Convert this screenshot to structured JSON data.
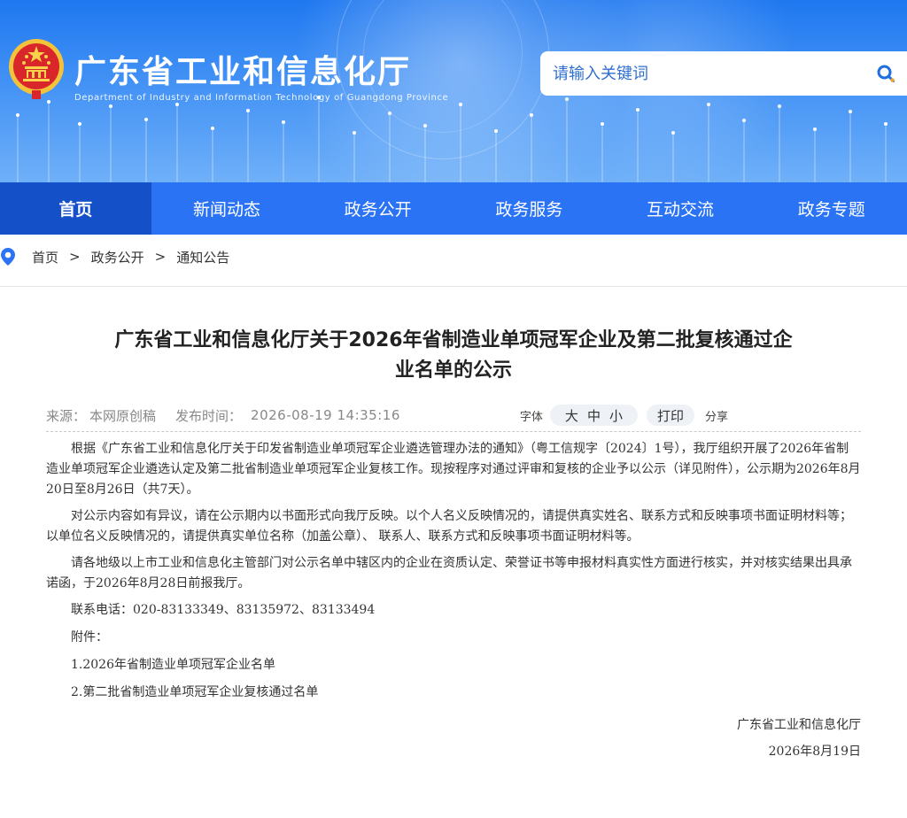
{
  "header": {
    "title": "广东省工业和信息化厅",
    "subtitle": "Department of Industry and Information Technology of Guangdong Province",
    "search_placeholder": "请输入关键词"
  },
  "nav": {
    "items": [
      {
        "label": "首页",
        "active": true
      },
      {
        "label": "新闻动态"
      },
      {
        "label": "政务公开"
      },
      {
        "label": "政务服务"
      },
      {
        "label": "互动交流"
      },
      {
        "label": "政务专题"
      }
    ]
  },
  "breadcrumb": {
    "sep": ">",
    "items": [
      "首页",
      "政务公开",
      "通知公告"
    ]
  },
  "article": {
    "title_line1": "广东省工业和信息化厅关于2026年省制造业单项冠军企业及第二批复核通过企",
    "title_line2": "业名单的公示",
    "source_label": "来源：",
    "source_value": "本网原创稿",
    "date_label": "发布时间：",
    "date_value": "2026-08-19 14:35:16",
    "font_label": "字体",
    "font_sizes": [
      "大",
      "中",
      "小"
    ],
    "print_label": "打印",
    "share_label": "分享",
    "paragraphs": [
      "根据《广东省工业和信息化厅关于印发省制造业单项冠军企业遴选管理办法的通知》（粤工信规字〔2024〕1号），我厅组织开展了2026年省制造业单项冠军企业遴选认定及第二批省制造业单项冠军企业复核工作。现按程序对通过评审和复核的企业予以公示（详见附件），公示期为2026年8月20日至8月26日（共7天）。",
      "对公示内容如有异议，请在公示期内以书面形式向我厅反映。以个人名义反映情况的，请提供真实姓名、联系方式和反映事项书面证明材料等；以单位名义反映情况的，请提供真实单位名称（加盖公章）、 联系人、联系方式和反映事项书面证明材料等。",
      "请各地级以上市工业和信息化主管部门对公示名单中辖区内的企业在资质认定、荣誉证书等申报材料真实性方面进行核实，并对核实结果出具承诺函，于2026年8月28日前报我厅。"
    ],
    "contact": "联系电话：020-83133349、83135972、83133494",
    "attachments_label": "附件：",
    "attachments": [
      "1.2026年省制造业单项冠军企业名单",
      "2.第二批省制造业单项冠军企业复核通过名单"
    ],
    "signature_org": "广东省工业和信息化厅",
    "signature_date": "2026年8月19日"
  },
  "colors": {
    "nav_bg": "#2b73f5",
    "nav_active": "#1450c8",
    "banner_top": "#1f78f0",
    "accent": "#2f6fd0"
  }
}
